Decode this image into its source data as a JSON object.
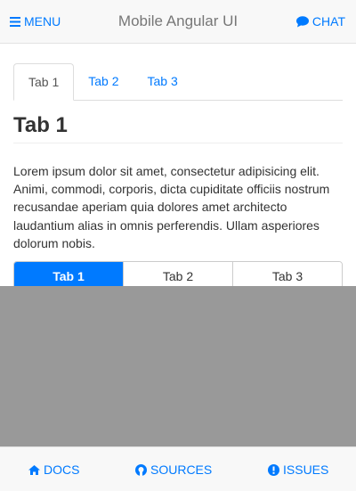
{
  "navbar": {
    "menu_label": "MENU",
    "title": "Mobile Angular UI",
    "chat_label": "CHAT",
    "menu_icon": "bars-icon",
    "chat_icon": "comment-icon"
  },
  "tabs": {
    "items": [
      "Tab 1",
      "Tab 2",
      "Tab 3"
    ],
    "active_index": 0
  },
  "tab_content": {
    "heading": "Tab 1",
    "body": "Lorem ipsum dolor sit amet, consectetur adipisicing elit. Animi, commodi, corporis, dicta cupiditate officiis nostrum recusandae aperiam quia dolores amet architecto laudantium alias in omnis perferendis. Ullam asperiores dolorum nobis."
  },
  "segmented": {
    "items": [
      "Tab 1",
      "Tab 2",
      "Tab 3"
    ],
    "active_index": 0
  },
  "bottom_nav": {
    "docs_label": "DOCS",
    "sources_label": "SOURCES",
    "issues_label": "ISSUES",
    "docs_icon": "home-icon",
    "sources_icon": "github-icon",
    "issues_icon": "exclamation-circle-icon"
  },
  "colors": {
    "accent": "#007aff",
    "navbar_bg": "#f8f8f8",
    "backdrop": "#999999"
  }
}
